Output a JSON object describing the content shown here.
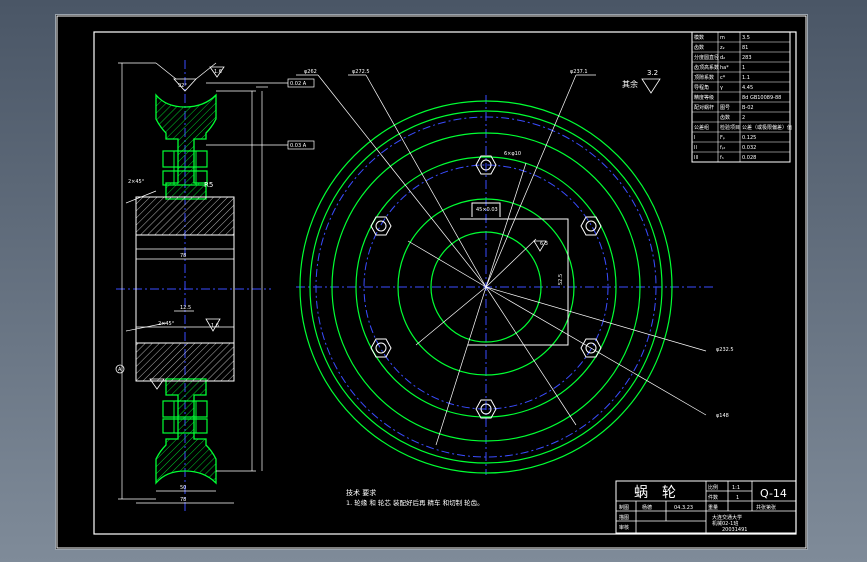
{
  "drawing": {
    "note_title": "技术 要求",
    "note_line": "1. 轮缘 和 轮芯 装配好后再 精车 和切制 轮齿。",
    "surface_rest": "其余",
    "surface_rest_value": "3.2"
  },
  "side_view": {
    "dims": {
      "angle": "92°",
      "chamfer_top": "2×45°",
      "radius": "R5",
      "chamfer_bottom": "2×45°",
      "width_inner": "78",
      "w1": "12.5",
      "w2": "50",
      "w3": "78",
      "sym": "A",
      "rough1": "1.6",
      "rough2": "1.6",
      "tol1": "0.02 A",
      "tol2": "0.03 A"
    }
  },
  "front_view": {
    "dims": {
      "d1": "φ262",
      "d2": "φ272.5",
      "d3": "φ237.1",
      "hole": "6×φ10",
      "key": "45×0.03",
      "rough": "6.3",
      "d4": "φ232.5",
      "d5": "φ148",
      "len": "52.5"
    }
  },
  "param_table": {
    "rows": [
      [
        "模数",
        "m",
        "3.5"
      ],
      [
        "齿数",
        "z₂",
        "81"
      ],
      [
        "分度圆直径",
        "d₂",
        "283"
      ],
      [
        "齿顶高系数",
        "ha*",
        "1"
      ],
      [
        "顶隙系数",
        "c*",
        "1.1"
      ],
      [
        "导程角",
        "γ",
        "4.45"
      ],
      [
        "精度等级",
        "",
        "8d GB10089-88"
      ],
      [
        "配对蜗杆",
        "图号",
        "B-02"
      ],
      [
        "",
        "齿数",
        "2"
      ],
      [
        "公差组",
        "检验项目",
        "公差（或极限偏差）值"
      ],
      [
        "I",
        "Fₚ",
        "0.125"
      ],
      [
        "II",
        "fₚₜ",
        "0.032"
      ],
      [
        "III",
        "fₕ",
        "0.028"
      ]
    ]
  },
  "title_block": {
    "name": "蜗　轮",
    "code": "Q-14",
    "scale_label": "比例",
    "scale_value": "1:1",
    "qty_label": "件数",
    "qty_value": "1",
    "weight_label": "重量",
    "sheet_label": "共张第张",
    "drawn_label": "制图",
    "drawn_name": "杨德",
    "date": "04.3.23",
    "check_label": "描图",
    "review_label": "审核",
    "material": "材料",
    "school": "大连交通大学",
    "class": "机械02-1班",
    "student_id": "20031491"
  }
}
